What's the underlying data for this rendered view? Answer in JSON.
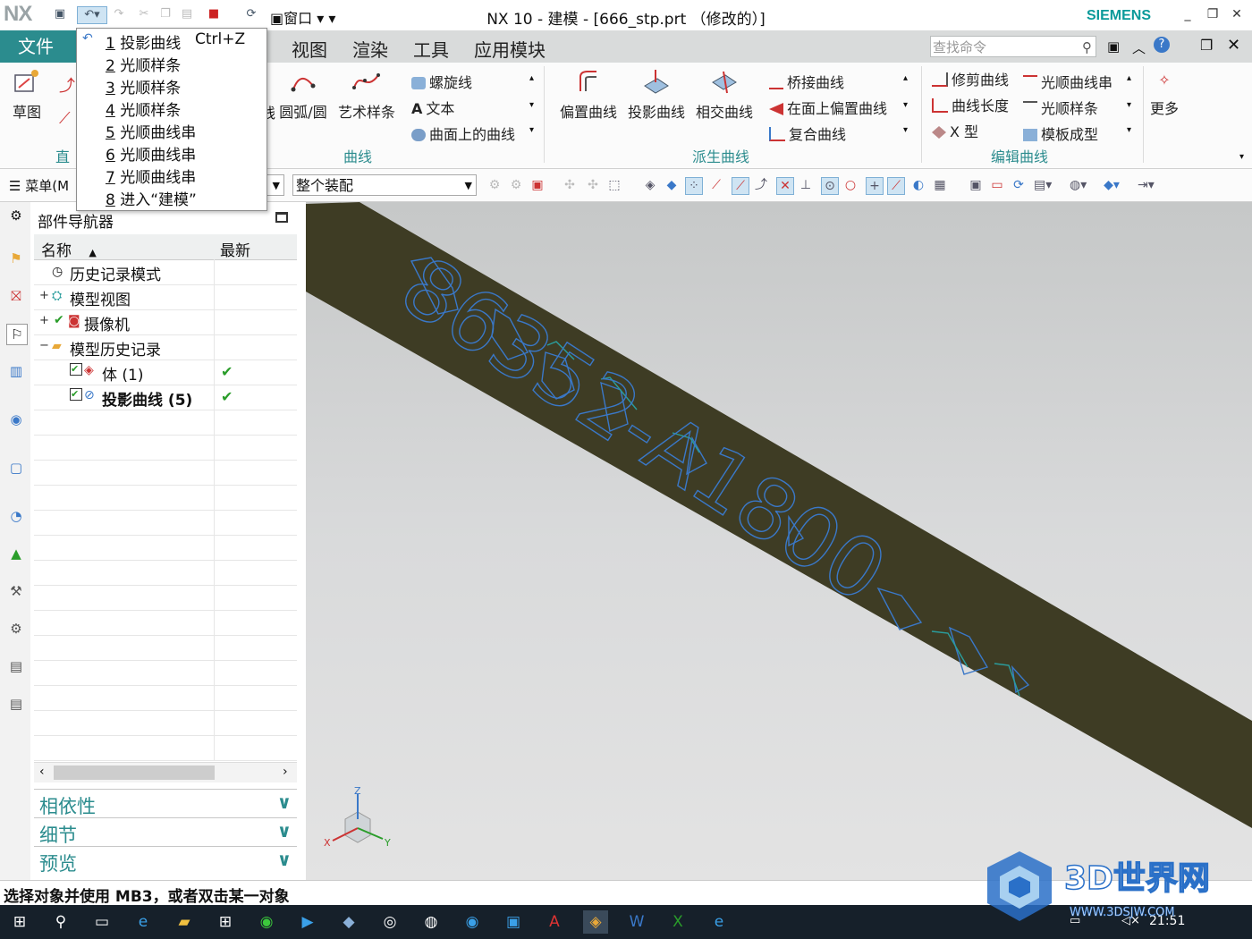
{
  "window": {
    "logo": "NX",
    "title": "NX 10 - 建模 - [666_stp.prt （修改的）]",
    "brand": "SIEMENS",
    "window_menu": "窗口"
  },
  "menubar": {
    "file": "文件(F)",
    "tabs": [
      "视图",
      "渲染",
      "工具",
      "应用模块"
    ],
    "search_placeholder": "查找命令"
  },
  "undo_list": {
    "shortcut": "Ctrl+Z",
    "items": [
      {
        "num": "1",
        "label": "投影曲线"
      },
      {
        "num": "2",
        "label": "光顺样条"
      },
      {
        "num": "3",
        "label": "光顺样条"
      },
      {
        "num": "4",
        "label": "光顺样条"
      },
      {
        "num": "5",
        "label": "光顺曲线串"
      },
      {
        "num": "6",
        "label": "光顺曲线串"
      },
      {
        "num": "7",
        "label": "光顺曲线串"
      },
      {
        "num": "8",
        "label": "进入“建模”"
      }
    ]
  },
  "ribbon": {
    "sketch": "草图",
    "direct_partial": "直",
    "arc": "圆弧/圆",
    "art_spline": "艺术样条",
    "curve_group": "曲线",
    "helix": "螺旋线",
    "text": "文本",
    "curve_on_surface": "曲面上的曲线",
    "offset_curve": "偏置曲线",
    "project_curve": "投影曲线",
    "intersect_curve": "相交曲线",
    "bridge_curve": "桥接曲线",
    "offset_in_face": "在面上偏置曲线",
    "composite_curve": "复合曲线",
    "derived_group": "派生曲线",
    "trim_curve": "修剪曲线",
    "curve_length": "曲线长度",
    "x_form": "X 型",
    "smooth_curve_string": "光顺曲线串",
    "smooth_spline": "光顺样条",
    "template_shape": "模板成型",
    "edit_group": "编辑曲线",
    "more": "更多"
  },
  "toolbar2": {
    "menu": "菜单(M",
    "filter_value": "整个装配"
  },
  "navigator": {
    "title": "部件导航器",
    "col_name": "名称",
    "col_latest": "最新",
    "rows": [
      {
        "label": "历史记录模式"
      },
      {
        "label": "模型视图"
      },
      {
        "label": "摄像机"
      },
      {
        "label": "模型历史记录"
      },
      {
        "label": "体 (1)"
      },
      {
        "label": "投影曲线 (5)"
      }
    ],
    "panels": [
      "相依性",
      "细节",
      "预览"
    ]
  },
  "viewport": {
    "engraved_text": "86352-A1800",
    "triad": {
      "z": "Z",
      "x": "X",
      "y": "Y"
    }
  },
  "status": "选择对象并使用 MB3，或者双击某一对象",
  "taskbar": {
    "clock": "21:51"
  },
  "watermark": {
    "title": "3D世界网",
    "url": "WWW.3DSJW.COM"
  },
  "colors": {
    "accent": "#2b8c8e",
    "strip": "#3e3c24",
    "curve_blue": "#3a78c8"
  }
}
